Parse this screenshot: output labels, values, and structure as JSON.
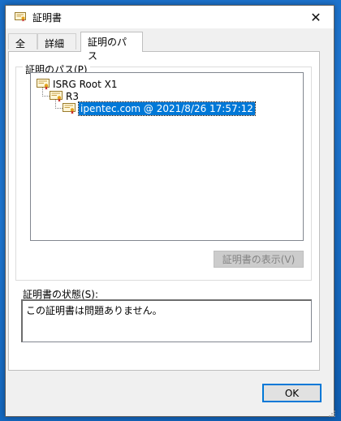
{
  "window": {
    "title": "証明書",
    "close_glyph": "✕"
  },
  "tabs": [
    {
      "label": "全般",
      "active": false
    },
    {
      "label": "詳細",
      "active": false
    },
    {
      "label": "証明のパス",
      "active": true
    }
  ],
  "cert_path": {
    "group_label": "証明のパス(P)",
    "nodes": [
      {
        "label": "ISRG Root X1",
        "icon": "certificate-icon",
        "selected": false
      },
      {
        "label": "R3",
        "icon": "certificate-icon",
        "selected": false
      },
      {
        "label": "ipentec.com @ 2021/8/26 17:57:12",
        "icon": "certificate-icon",
        "selected": true
      }
    ],
    "view_button_label": "証明書の表示(V)",
    "view_button_enabled": false
  },
  "status": {
    "label": "証明書の状態(S):",
    "value": "この証明書は問題ありません。"
  },
  "footer": {
    "ok_label": "OK"
  },
  "colors": {
    "accent": "#0078d7",
    "desktop": "#1f78d4",
    "dialog_bg": "#f0f0f0"
  }
}
